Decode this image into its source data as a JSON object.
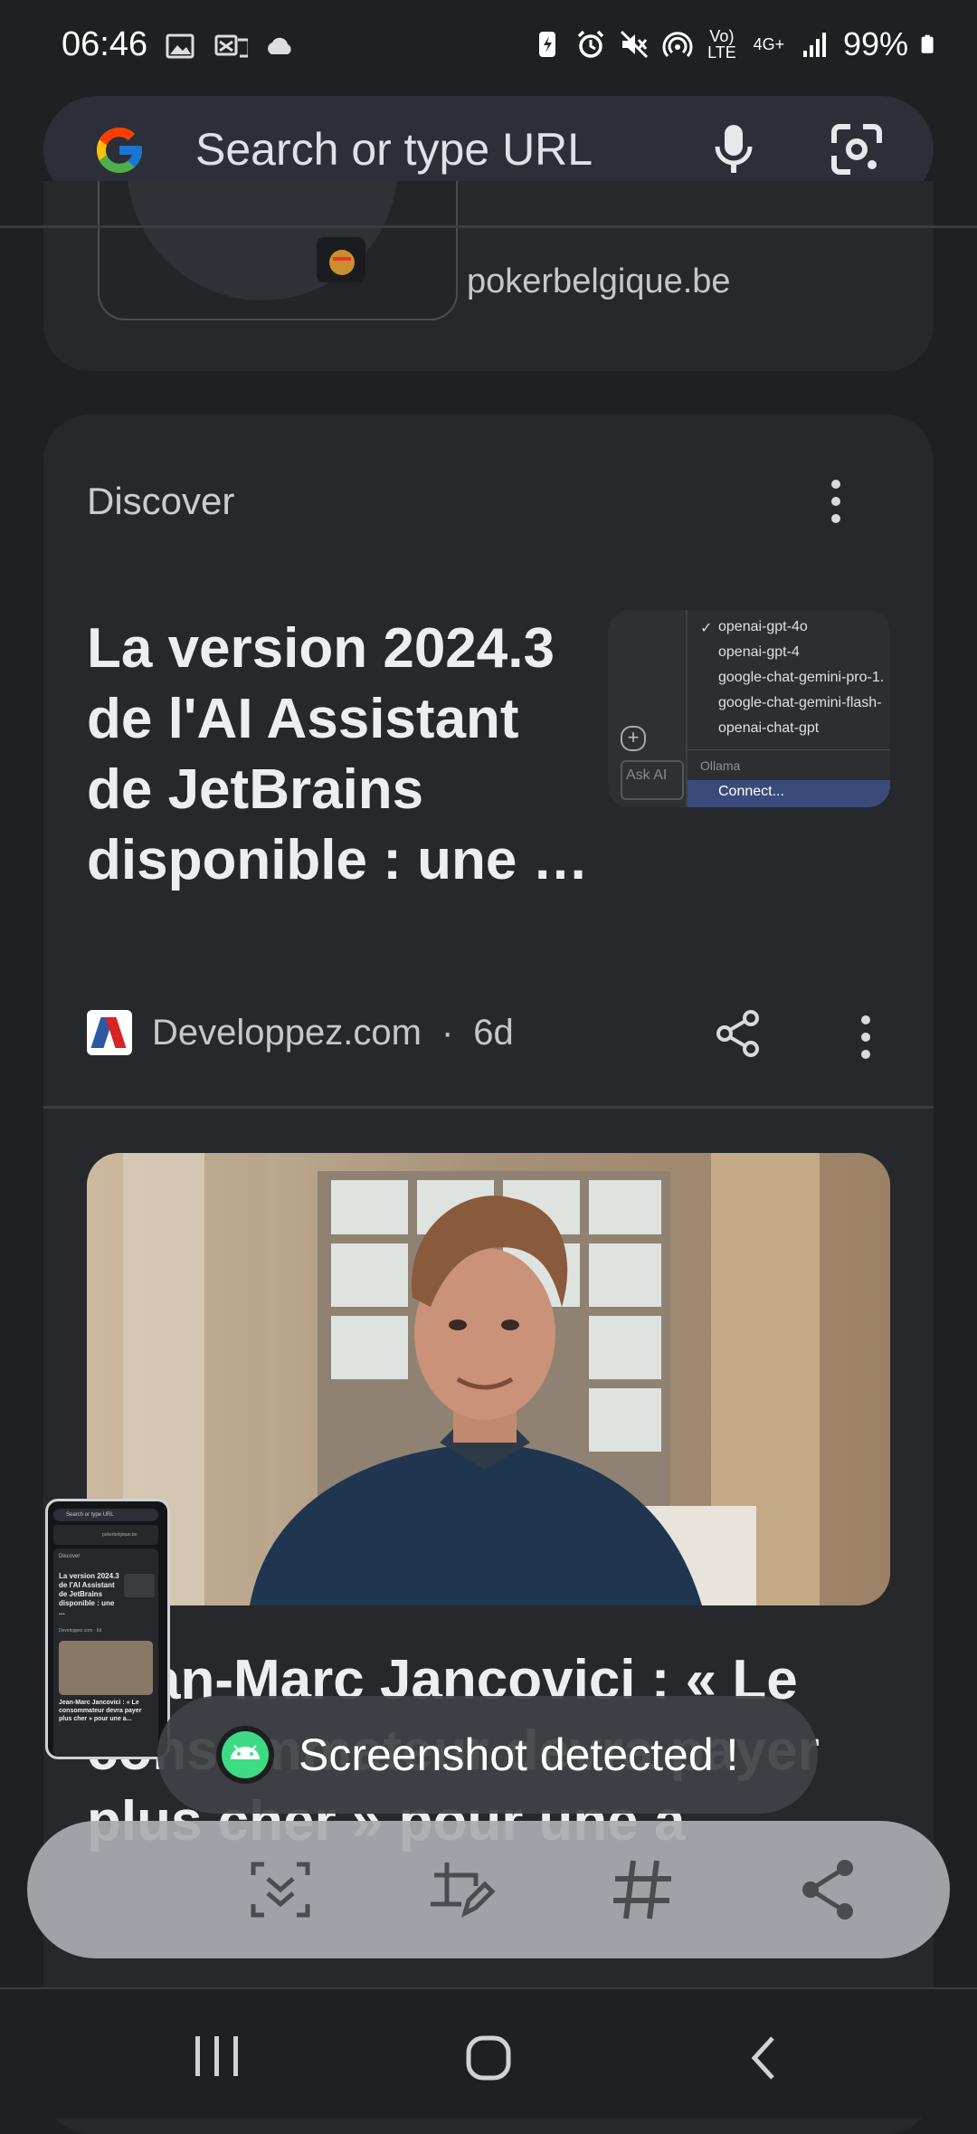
{
  "status_bar": {
    "time": "06:46",
    "network_label": "Vo) LTE",
    "network_gen": "4G+",
    "battery": "99%"
  },
  "omnibox": {
    "placeholder": "Search or type URL",
    "icons": [
      "google-g-icon",
      "mic-icon",
      "google-lens-icon"
    ]
  },
  "previous_card": {
    "domain": "pokerbelgique.be"
  },
  "discover": {
    "title": "Discover",
    "articles": [
      {
        "headline": "La version 2024.3 de l'AI Assistant de JetBrains disponible : une …",
        "source": "Developpez.com",
        "age": "6d",
        "thumbnail_menu": {
          "items": [
            "openai-gpt-4o",
            "openai-gpt-4",
            "google-chat-gemini-pro-1.",
            "google-chat-gemini-flash-",
            "openai-chat-gpt"
          ],
          "checked": "openai-gpt-4o",
          "section": "Ollama",
          "action": "Connect...",
          "input_hint": "Ask AI"
        }
      },
      {
        "headline": "Jean-Marc Jancovici : « Le consommateur devra payer plus cher » pour une a"
      }
    ]
  },
  "mini_screenshot": {
    "search": "Search or type URL",
    "domain": "pokerbelgique.be",
    "discover": "Discover",
    "headline": "La version 2024.3 de l'AI Assistant de JetBrains disponible : une ...",
    "meta": "Developpez.com · 6d",
    "headline2": "Jean-Marc Jancovici : « Le consommateur devra payer plus cher » pour une a..."
  },
  "toast": {
    "label": "Screenshot detected !"
  },
  "toolbar": {
    "buttons": [
      "scroll-capture-icon",
      "draw-edit-icon",
      "hashtag-icon",
      "share-icon"
    ]
  },
  "colors": {
    "background": "#1f2023",
    "card": "#26282c",
    "omnibox": "#2c2f37",
    "toolbar": "#aaacb0"
  }
}
